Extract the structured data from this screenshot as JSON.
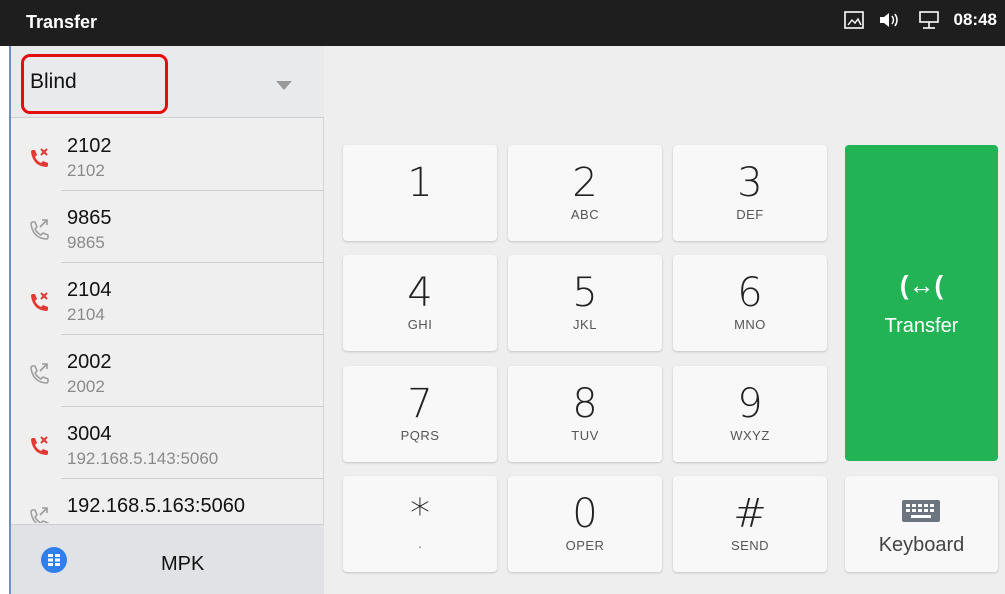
{
  "status_bar": {
    "title": "Transfer",
    "time": "08:48",
    "icons": [
      "screenshot-icon",
      "volume-icon",
      "network-icon"
    ]
  },
  "transfer_mode": {
    "selected": "Blind"
  },
  "call_history": [
    {
      "name": "2102",
      "sub": "2102",
      "type": "missed"
    },
    {
      "name": "9865",
      "sub": "9865",
      "type": "outgoing"
    },
    {
      "name": "2104",
      "sub": "2104",
      "type": "missed"
    },
    {
      "name": "2002",
      "sub": "2002",
      "type": "outgoing"
    },
    {
      "name": "3004",
      "sub": "192.168.5.143:5060",
      "type": "missed"
    },
    {
      "name": "192.168.5.163:5060",
      "sub": "",
      "type": "outgoing"
    }
  ],
  "bottom_bar": {
    "mpk_label": "MPK"
  },
  "keypad": [
    {
      "digit": "1",
      "letters": ""
    },
    {
      "digit": "2",
      "letters": "ABC"
    },
    {
      "digit": "3",
      "letters": "DEF"
    },
    {
      "digit": "4",
      "letters": "GHI"
    },
    {
      "digit": "5",
      "letters": "JKL"
    },
    {
      "digit": "6",
      "letters": "MNO"
    },
    {
      "digit": "7",
      "letters": "PQRS"
    },
    {
      "digit": "8",
      "letters": "TUV"
    },
    {
      "digit": "9",
      "letters": "WXYZ"
    },
    {
      "digit": "*",
      "letters": "·"
    },
    {
      "digit": "0",
      "letters": "OPER"
    },
    {
      "digit": "#",
      "letters": "SEND"
    }
  ],
  "actions": {
    "transfer_icon": "(↔(",
    "transfer_label": "Transfer",
    "keyboard_label": "Keyboard"
  },
  "colors": {
    "status_bar": "#1e1e1e",
    "transfer_green": "#22b454",
    "missed_red": "#e53935",
    "highlight_red": "#e01010",
    "mpk_blue": "#2f80ed"
  }
}
